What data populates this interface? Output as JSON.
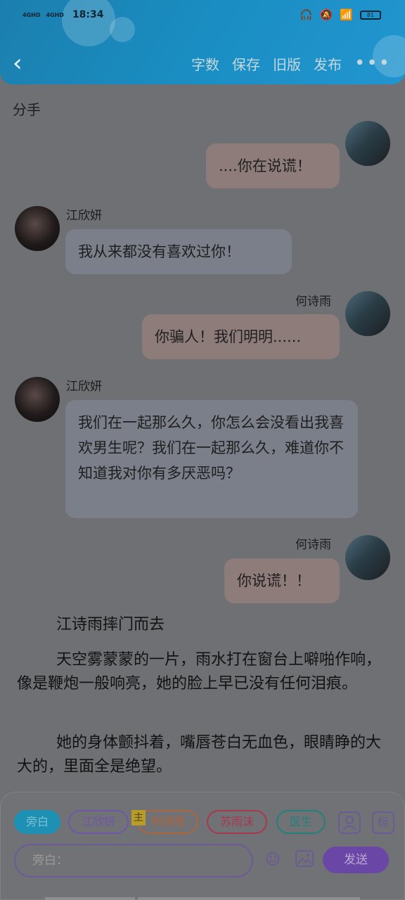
{
  "status": {
    "signal1": "4GHD",
    "signal2": "4GHD",
    "time": "18:34",
    "battery": "81"
  },
  "toolbar": {
    "word_count": "字数",
    "save": "保存",
    "old_version": "旧版",
    "publish": "发布",
    "more": "•••"
  },
  "doc": {
    "title": "分手"
  },
  "messages": [
    {
      "side": "right",
      "name": "",
      "text": "....你在说谎！"
    },
    {
      "side": "left",
      "name": "江欣妍",
      "text": "我从来都没有喜欢过你！"
    },
    {
      "side": "right",
      "name": "何诗雨",
      "text": "你骗人！我们明明......"
    },
    {
      "side": "left",
      "name": "江欣妍",
      "text": "我们在一起那么久，你怎么会没看出我喜欢男生呢？我们在一起那么久，难道你不知道我对你有多厌恶吗？"
    },
    {
      "side": "right",
      "name": "何诗雨",
      "text": "你说谎！！"
    }
  ],
  "narration": [
    "江诗雨摔门而去",
    "天空雾蒙蒙的一片，雨水打在窗台上噼啪作响，像是鞭炮一般响亮，她的脸上早已没有任何泪痕。",
    "她的身体颤抖着，嘴唇苍白无血色，眼睛睁的大大的，里面全是绝望。"
  ],
  "characters": [
    {
      "label": "旁白",
      "color": "#1e90b4"
    },
    {
      "label": "江欣妍",
      "color": "#6f56a8"
    },
    {
      "label": "何诗雨",
      "color": "#b0643a"
    },
    {
      "label": "苏雨沫",
      "color": "#a8384e"
    },
    {
      "label": "医生",
      "color": "#23807a"
    }
  ],
  "main_badge": "主",
  "icons": {
    "person": "person-icon",
    "tag": "标"
  },
  "input": {
    "placeholder": "旁白："
  },
  "send_label": "发送"
}
